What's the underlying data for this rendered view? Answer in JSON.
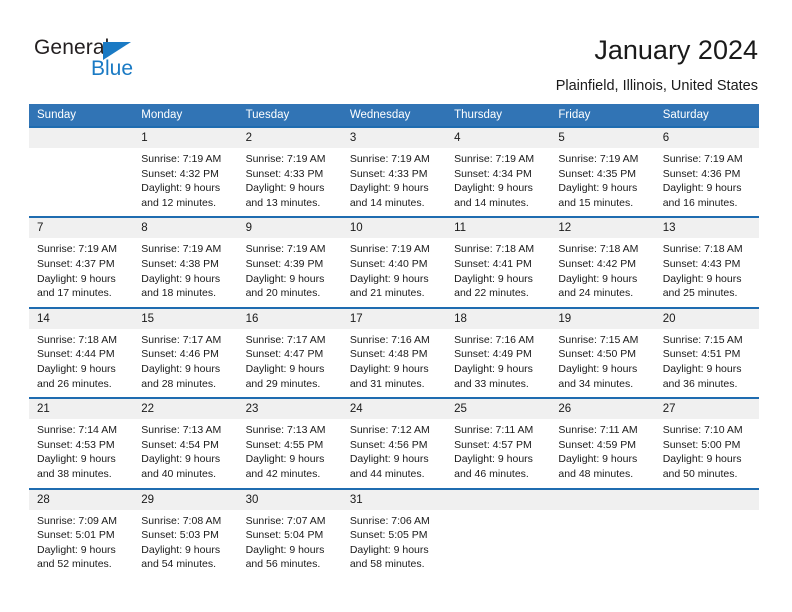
{
  "brand": {
    "name_top": "General",
    "name_bottom": "Blue",
    "triangle_icon": "triangle-icon",
    "color_dark": "#231f20",
    "color_blue": "#1a7ac4"
  },
  "header": {
    "title": "January 2024",
    "subtitle": "Plainfield, Illinois, United States"
  },
  "theme": {
    "header_blue": "#3174b5",
    "separator_blue": "#1f6cb0",
    "daynum_band": "#f0f0f0",
    "text": "#1a1a1a"
  },
  "calendar": {
    "weekday_headers": [
      "Sunday",
      "Monday",
      "Tuesday",
      "Wednesday",
      "Thursday",
      "Friday",
      "Saturday"
    ],
    "weeks": [
      [
        {
          "day": "",
          "lines": []
        },
        {
          "day": "1",
          "lines": [
            "Sunrise: 7:19 AM",
            "Sunset: 4:32 PM",
            "Daylight: 9 hours",
            "and 12 minutes."
          ]
        },
        {
          "day": "2",
          "lines": [
            "Sunrise: 7:19 AM",
            "Sunset: 4:33 PM",
            "Daylight: 9 hours",
            "and 13 minutes."
          ]
        },
        {
          "day": "3",
          "lines": [
            "Sunrise: 7:19 AM",
            "Sunset: 4:33 PM",
            "Daylight: 9 hours",
            "and 14 minutes."
          ]
        },
        {
          "day": "4",
          "lines": [
            "Sunrise: 7:19 AM",
            "Sunset: 4:34 PM",
            "Daylight: 9 hours",
            "and 14 minutes."
          ]
        },
        {
          "day": "5",
          "lines": [
            "Sunrise: 7:19 AM",
            "Sunset: 4:35 PM",
            "Daylight: 9 hours",
            "and 15 minutes."
          ]
        },
        {
          "day": "6",
          "lines": [
            "Sunrise: 7:19 AM",
            "Sunset: 4:36 PM",
            "Daylight: 9 hours",
            "and 16 minutes."
          ]
        }
      ],
      [
        {
          "day": "7",
          "lines": [
            "Sunrise: 7:19 AM",
            "Sunset: 4:37 PM",
            "Daylight: 9 hours",
            "and 17 minutes."
          ]
        },
        {
          "day": "8",
          "lines": [
            "Sunrise: 7:19 AM",
            "Sunset: 4:38 PM",
            "Daylight: 9 hours",
            "and 18 minutes."
          ]
        },
        {
          "day": "9",
          "lines": [
            "Sunrise: 7:19 AM",
            "Sunset: 4:39 PM",
            "Daylight: 9 hours",
            "and 20 minutes."
          ]
        },
        {
          "day": "10",
          "lines": [
            "Sunrise: 7:19 AM",
            "Sunset: 4:40 PM",
            "Daylight: 9 hours",
            "and 21 minutes."
          ]
        },
        {
          "day": "11",
          "lines": [
            "Sunrise: 7:18 AM",
            "Sunset: 4:41 PM",
            "Daylight: 9 hours",
            "and 22 minutes."
          ]
        },
        {
          "day": "12",
          "lines": [
            "Sunrise: 7:18 AM",
            "Sunset: 4:42 PM",
            "Daylight: 9 hours",
            "and 24 minutes."
          ]
        },
        {
          "day": "13",
          "lines": [
            "Sunrise: 7:18 AM",
            "Sunset: 4:43 PM",
            "Daylight: 9 hours",
            "and 25 minutes."
          ]
        }
      ],
      [
        {
          "day": "14",
          "lines": [
            "Sunrise: 7:18 AM",
            "Sunset: 4:44 PM",
            "Daylight: 9 hours",
            "and 26 minutes."
          ]
        },
        {
          "day": "15",
          "lines": [
            "Sunrise: 7:17 AM",
            "Sunset: 4:46 PM",
            "Daylight: 9 hours",
            "and 28 minutes."
          ]
        },
        {
          "day": "16",
          "lines": [
            "Sunrise: 7:17 AM",
            "Sunset: 4:47 PM",
            "Daylight: 9 hours",
            "and 29 minutes."
          ]
        },
        {
          "day": "17",
          "lines": [
            "Sunrise: 7:16 AM",
            "Sunset: 4:48 PM",
            "Daylight: 9 hours",
            "and 31 minutes."
          ]
        },
        {
          "day": "18",
          "lines": [
            "Sunrise: 7:16 AM",
            "Sunset: 4:49 PM",
            "Daylight: 9 hours",
            "and 33 minutes."
          ]
        },
        {
          "day": "19",
          "lines": [
            "Sunrise: 7:15 AM",
            "Sunset: 4:50 PM",
            "Daylight: 9 hours",
            "and 34 minutes."
          ]
        },
        {
          "day": "20",
          "lines": [
            "Sunrise: 7:15 AM",
            "Sunset: 4:51 PM",
            "Daylight: 9 hours",
            "and 36 minutes."
          ]
        }
      ],
      [
        {
          "day": "21",
          "lines": [
            "Sunrise: 7:14 AM",
            "Sunset: 4:53 PM",
            "Daylight: 9 hours",
            "and 38 minutes."
          ]
        },
        {
          "day": "22",
          "lines": [
            "Sunrise: 7:13 AM",
            "Sunset: 4:54 PM",
            "Daylight: 9 hours",
            "and 40 minutes."
          ]
        },
        {
          "day": "23",
          "lines": [
            "Sunrise: 7:13 AM",
            "Sunset: 4:55 PM",
            "Daylight: 9 hours",
            "and 42 minutes."
          ]
        },
        {
          "day": "24",
          "lines": [
            "Sunrise: 7:12 AM",
            "Sunset: 4:56 PM",
            "Daylight: 9 hours",
            "and 44 minutes."
          ]
        },
        {
          "day": "25",
          "lines": [
            "Sunrise: 7:11 AM",
            "Sunset: 4:57 PM",
            "Daylight: 9 hours",
            "and 46 minutes."
          ]
        },
        {
          "day": "26",
          "lines": [
            "Sunrise: 7:11 AM",
            "Sunset: 4:59 PM",
            "Daylight: 9 hours",
            "and 48 minutes."
          ]
        },
        {
          "day": "27",
          "lines": [
            "Sunrise: 7:10 AM",
            "Sunset: 5:00 PM",
            "Daylight: 9 hours",
            "and 50 minutes."
          ]
        }
      ],
      [
        {
          "day": "28",
          "lines": [
            "Sunrise: 7:09 AM",
            "Sunset: 5:01 PM",
            "Daylight: 9 hours",
            "and 52 minutes."
          ]
        },
        {
          "day": "29",
          "lines": [
            "Sunrise: 7:08 AM",
            "Sunset: 5:03 PM",
            "Daylight: 9 hours",
            "and 54 minutes."
          ]
        },
        {
          "day": "30",
          "lines": [
            "Sunrise: 7:07 AM",
            "Sunset: 5:04 PM",
            "Daylight: 9 hours",
            "and 56 minutes."
          ]
        },
        {
          "day": "31",
          "lines": [
            "Sunrise: 7:06 AM",
            "Sunset: 5:05 PM",
            "Daylight: 9 hours",
            "and 58 minutes."
          ]
        },
        {
          "day": "",
          "lines": []
        },
        {
          "day": "",
          "lines": []
        },
        {
          "day": "",
          "lines": []
        }
      ]
    ]
  }
}
